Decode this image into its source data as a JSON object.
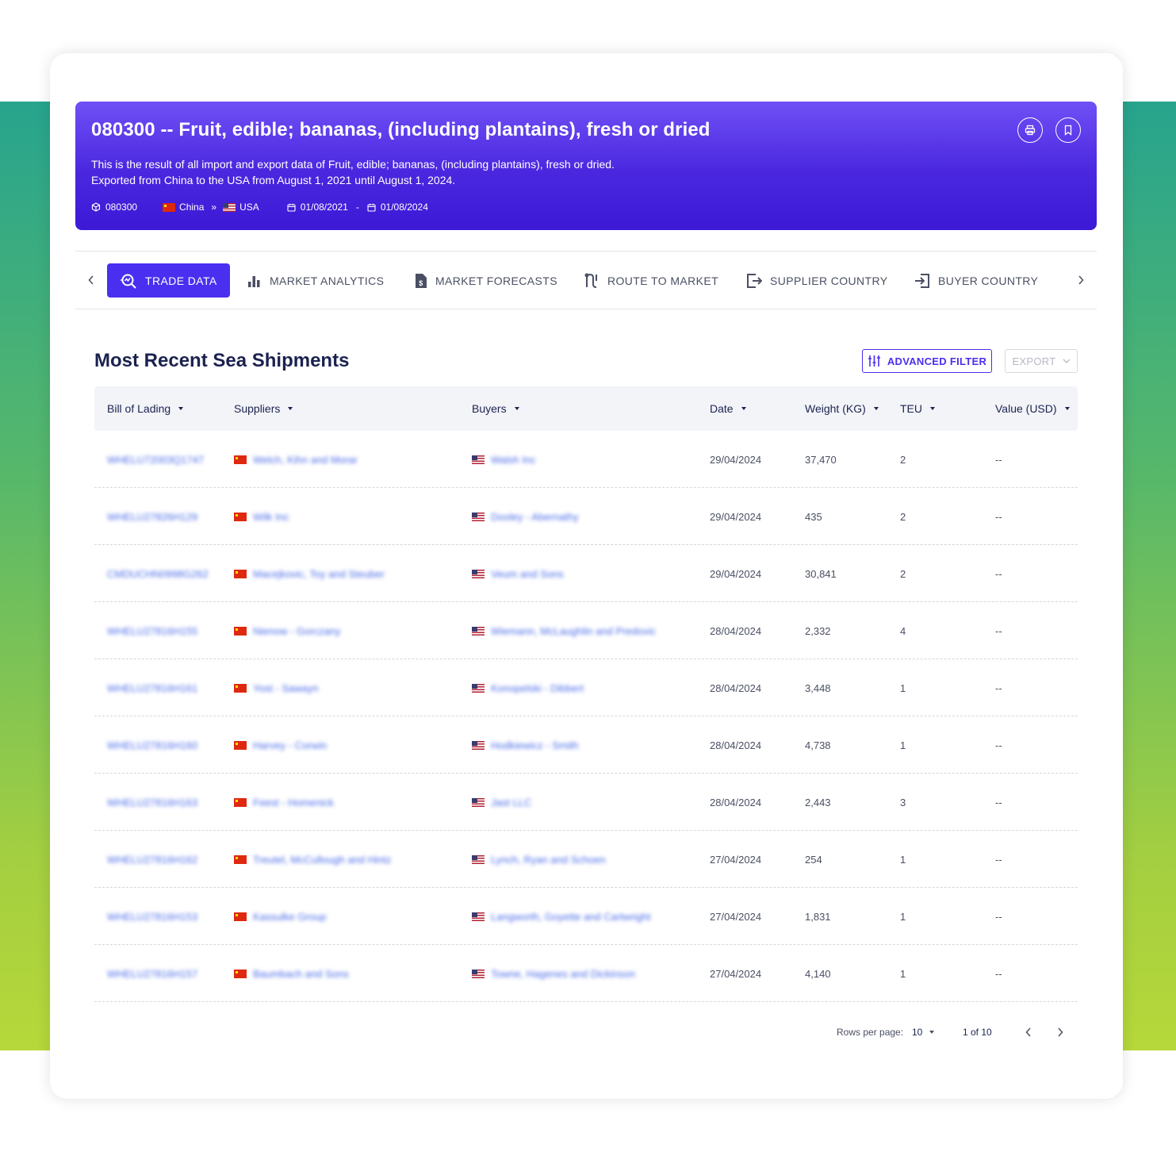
{
  "hero": {
    "title": "080300 -- Fruit, edible; bananas, (including plantains), fresh or dried",
    "desc_line1": "This is the result of all import and export data of Fruit, edible; bananas, (including plantains), fresh or dried.",
    "desc_line2": "Exported from China to the USA from August 1, 2021 until August 1, 2024.",
    "code": "080300",
    "origin": "China",
    "route_sep": "»",
    "destination": "USA",
    "date_from": "01/08/2021",
    "date_sep": "-",
    "date_to": "01/08/2024"
  },
  "tabs": [
    {
      "label": "TRADE DATA",
      "icon": "trade-search-icon",
      "active": true
    },
    {
      "label": "MARKET ANALYTICS",
      "icon": "bar-chart-icon"
    },
    {
      "label": "MARKET FORECASTS",
      "icon": "dollar-doc-icon"
    },
    {
      "label": "ROUTE TO MARKET",
      "icon": "route-icon"
    },
    {
      "label": "SUPPLIER COUNTRY",
      "icon": "export-icon"
    },
    {
      "label": "BUYER COUNTRY",
      "icon": "import-icon"
    }
  ],
  "section": {
    "title": "Most Recent Sea Shipments",
    "filter_label": "ADVANCED FILTER",
    "export_label": "EXPORT"
  },
  "columns": [
    "Bill of Lading",
    "Suppliers",
    "Buyers",
    "Date",
    "Weight (KG)",
    "TEU",
    "Value (USD)"
  ],
  "rows": [
    {
      "bol": "WHELU72003Q1747",
      "supplier": "Welch, Kihn and Morar",
      "buyer": "Walsh Inc",
      "date": "29/04/2024",
      "weight": "37,470",
      "teu": "2",
      "value": "--"
    },
    {
      "bol": "WHELU27826H129",
      "supplier": "Wilk Inc",
      "buyer": "Dooley - Abernathy",
      "date": "29/04/2024",
      "weight": "435",
      "teu": "2",
      "value": "--"
    },
    {
      "bol": "CMDUCHN0998G262",
      "supplier": "Macejkovic, Toy and Steuber",
      "buyer": "Veum and Sons",
      "date": "29/04/2024",
      "weight": "30,841",
      "teu": "2",
      "value": "--"
    },
    {
      "bol": "WHELU27816H155",
      "supplier": "Nienow - Gorczany",
      "buyer": "Wiemann, McLaughlin and Predovic",
      "date": "28/04/2024",
      "weight": "2,332",
      "teu": "4",
      "value": "--"
    },
    {
      "bol": "WHELU27816H161",
      "supplier": "Yost - Sawayn",
      "buyer": "Konopelski - Dibbert",
      "date": "28/04/2024",
      "weight": "3,448",
      "teu": "1",
      "value": "--"
    },
    {
      "bol": "WHELU27816H160",
      "supplier": "Harvey - Corwin",
      "buyer": "Hodkiewicz - Smith",
      "date": "28/04/2024",
      "weight": "4,738",
      "teu": "1",
      "value": "--"
    },
    {
      "bol": "WHELU27816H163",
      "supplier": "Feest - Homenick",
      "buyer": "Jast LLC",
      "date": "28/04/2024",
      "weight": "2,443",
      "teu": "3",
      "value": "--"
    },
    {
      "bol": "WHELU27816H162",
      "supplier": "Treutel, McCullough and Hintz",
      "buyer": "Lynch, Ryan and Schoen",
      "date": "27/04/2024",
      "weight": "254",
      "teu": "1",
      "value": "--"
    },
    {
      "bol": "WHELU27816H153",
      "supplier": "Kassulke Group",
      "buyer": "Langworth, Goyette and Cartwright",
      "date": "27/04/2024",
      "weight": "1,831",
      "teu": "1",
      "value": "--"
    },
    {
      "bol": "WHELU27816H157",
      "supplier": "Baumbach and Sons",
      "buyer": "Towne, Hagenes and Dickinson",
      "date": "27/04/2024",
      "weight": "4,140",
      "teu": "1",
      "value": "--"
    }
  ],
  "pagination": {
    "rows_label": "Rows per page:",
    "rows_value": "10",
    "page_info": "1 of 10"
  },
  "colors": {
    "accent": "#4a2ff0",
    "hero_top": "#7050f6",
    "hero_bottom": "#3c19d6",
    "link": "#4b6ce8",
    "heading": "#1b2250"
  }
}
